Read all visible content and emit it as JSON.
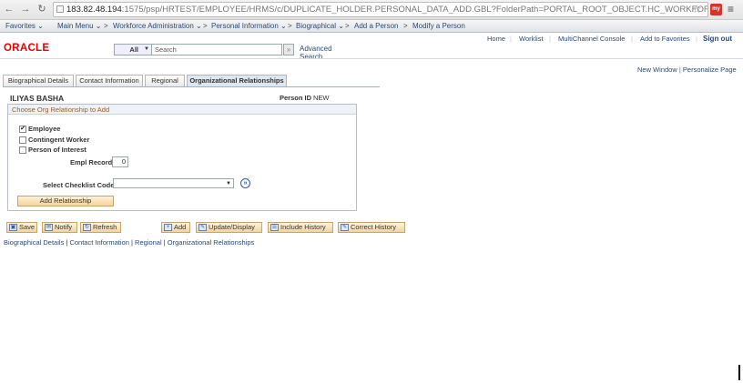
{
  "browser": {
    "url_host": "183.82.48.194",
    "url_rest": ":1575/psp/HRTEST/EMPLOYEE/HRMS/c/DUPLICATE_HOLDER.PERSONAL_DATA_ADD.GBL?FolderPath=PORTAL_ROOT_OBJECT.HC_WORKFORCE_ADMI",
    "ext_label": "my"
  },
  "nav": {
    "favorites": "Favorites ⌄",
    "main_menu": "Main Menu ⌄",
    "crumbs": [
      "Workforce Administration ⌄",
      "Personal Information ⌄",
      "Biographical ⌄",
      "Add a Person",
      "Modify a Person"
    ]
  },
  "header": {
    "logo": "ORACLE",
    "search_scope": "All",
    "search_placeholder": "Search",
    "advanced_search": "Advanced Search",
    "links": [
      "Home",
      "Worklist",
      "MultiChannel Console",
      "Add to Favorites"
    ],
    "sign_out": "Sign out",
    "new_window": "New Window",
    "personalize": "Personalize Page"
  },
  "tabs": [
    {
      "label": "Biographical Details",
      "active": false
    },
    {
      "label": "Contact Information",
      "active": false
    },
    {
      "label": "Regional",
      "active": false
    },
    {
      "label": "Organizational Relationships",
      "active": true
    }
  ],
  "person": {
    "name": "ILIYAS BASHA",
    "id_label": "Person ID",
    "id_value": "NEW"
  },
  "org_group": {
    "title": "Choose Org Relationship to Add",
    "options": [
      {
        "label": "Employee",
        "checked": true
      },
      {
        "label": "Contingent Worker",
        "checked": false
      },
      {
        "label": "Person of Interest",
        "checked": false
      }
    ],
    "empl_record_label": "Empl Record",
    "empl_record_value": "0",
    "checklist_label": "Select Checklist Code",
    "checklist_value": "",
    "add_relationship": "Add Relationship"
  },
  "toolbar": {
    "save": "Save",
    "notify": "Notify",
    "refresh": "Refresh",
    "add": "Add",
    "update_display": "Update/Display",
    "include_history": "Include History",
    "correct_history": "Correct History"
  },
  "footer_links": [
    "Biographical Details",
    "Contact Information",
    "Regional",
    "Organizational Relationships"
  ]
}
